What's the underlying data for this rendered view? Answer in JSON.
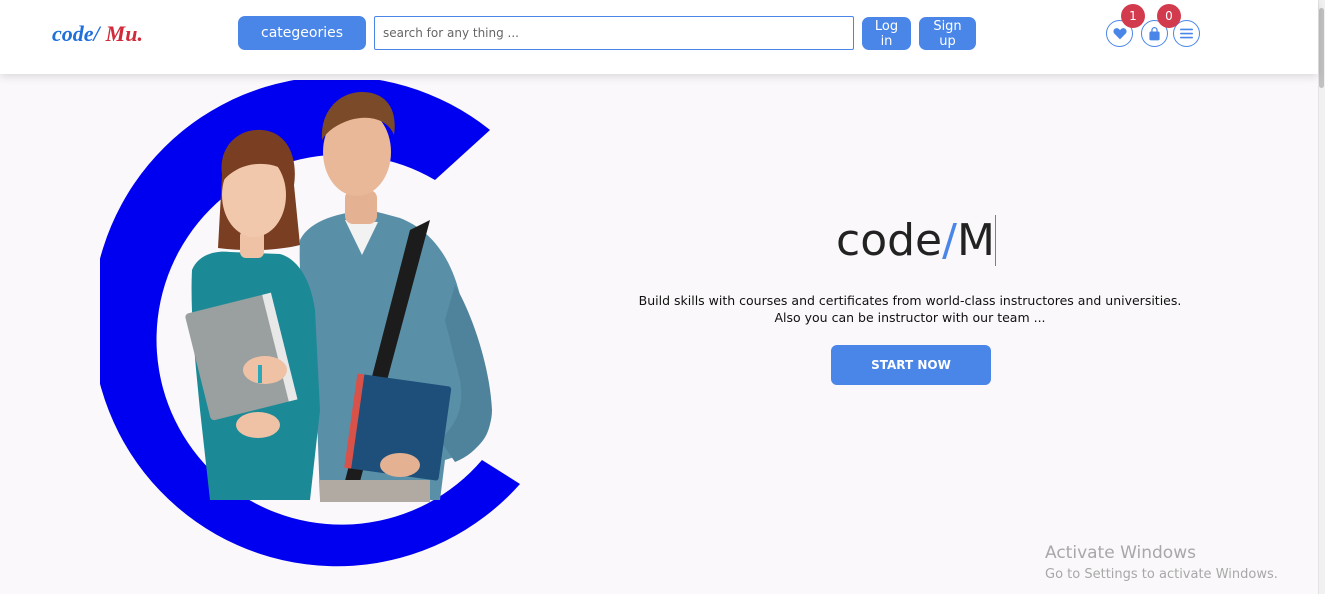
{
  "header": {
    "logo": {
      "part1": "code/",
      "part2": "Mu."
    },
    "categories_label": "categeories",
    "search": {
      "placeholder": "search for any thing ...",
      "value": ""
    },
    "login_label": "Log in",
    "signup_label": "Sign up",
    "favorites_count": "1",
    "cart_count": "0",
    "icons": [
      "heart-icon",
      "shopping-bag-icon",
      "menu-icon"
    ]
  },
  "hero": {
    "title_main": "code",
    "title_slash": "/",
    "title_cursor": "M",
    "description_line1": "Build skills with courses and certificates from world-class instructores and universities.",
    "description_line2": "Also you can be instructor with our team ...",
    "cta_label": "START NOW"
  },
  "watermark": {
    "title": "Activate Windows",
    "subtitle": "Go to Settings to activate Windows."
  },
  "colors": {
    "accent": "#4a86e8",
    "logo_blue": "#1f6fdc",
    "logo_red": "#d12a3a",
    "badge": "#d23a4e",
    "ring": "#0000f0",
    "background": "#faf8fa"
  }
}
